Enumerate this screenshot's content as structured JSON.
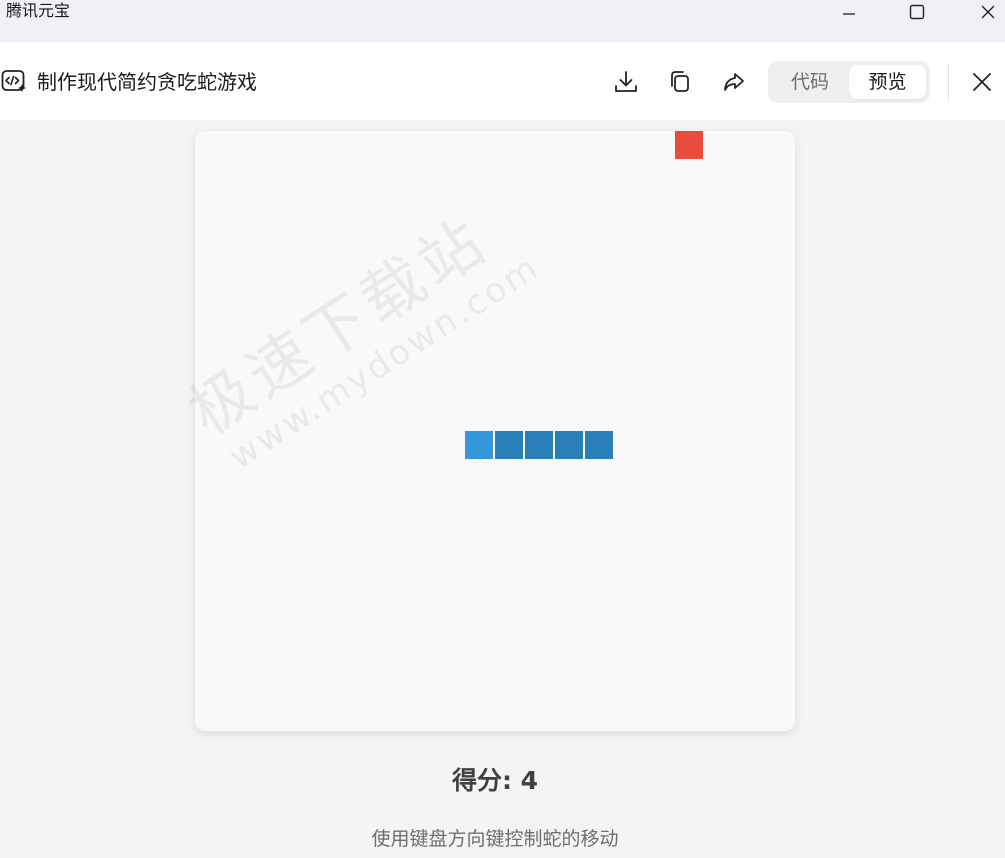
{
  "window": {
    "app_title": "腾讯元宝"
  },
  "header": {
    "title": "制作现代简约贪吃蛇游戏",
    "segmented": {
      "code_label": "代码",
      "preview_label": "预览",
      "selected": "预览"
    }
  },
  "game": {
    "score_text": "得分: 4",
    "hint_text": "使用键盘方向键控制蛇的移动",
    "colors": {
      "food": "#e74c3c",
      "snake_head": "#3498db",
      "snake_body": "#2980b9",
      "board": "#f9f9f9"
    }
  },
  "watermark": {
    "main": "极速下载站",
    "sub": "www.mydown.com"
  }
}
